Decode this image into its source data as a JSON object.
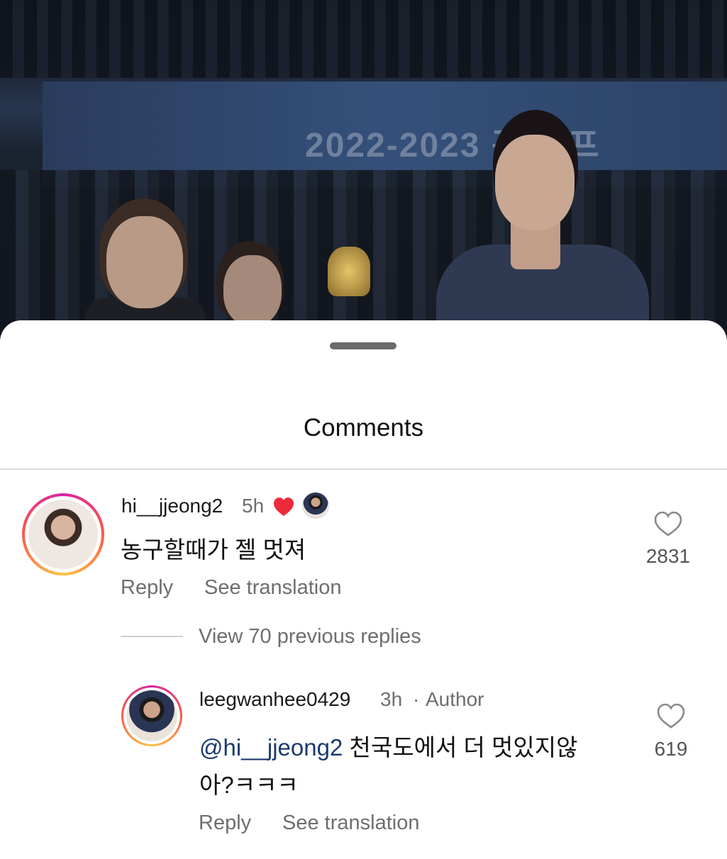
{
  "photo": {
    "banner_text": "2022-2023 관장 프"
  },
  "sheet": {
    "title": "Comments"
  },
  "comments": [
    {
      "username": "hi__jjeong2",
      "time": "5h",
      "text": "농구할때가 젤 멋져",
      "likes": "2831",
      "reply_label": "Reply",
      "translate_label": "See translation",
      "liked_by_author": true
    }
  ],
  "view_replies": "View 70 previous replies",
  "reply": {
    "username": "leegwanhee0429",
    "time": "3h",
    "separator": "·",
    "author_badge": "Author",
    "mention": "@hi__jjeong2",
    "text_line1": "천국도에서 더 멋있지않",
    "text_line2": "아?ㅋㅋㅋ",
    "likes": "619",
    "reply_label": "Reply",
    "translate_label": "See translation"
  },
  "colors": {
    "heart_red": "#ed2a3a",
    "mention": "#1c3b6d",
    "muted": "#6e6e6e"
  },
  "icons": [
    "heart-filled-icon",
    "heart-outline-icon"
  ]
}
